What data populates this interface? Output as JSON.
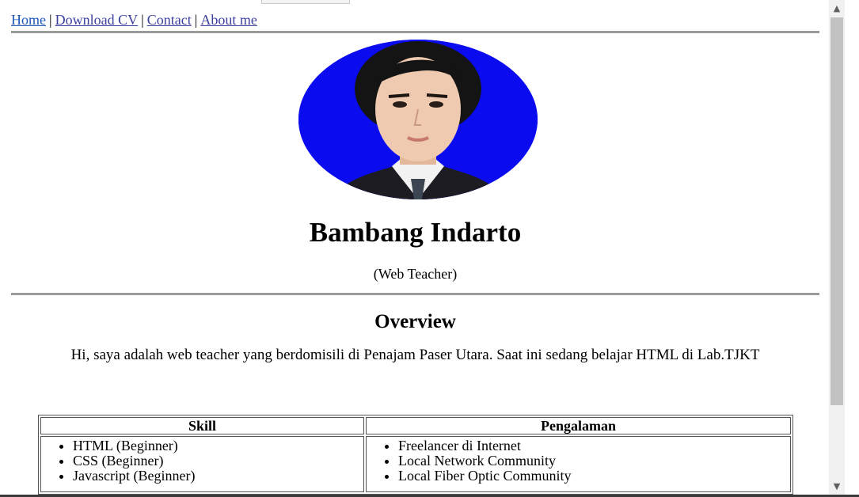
{
  "nav": {
    "links": [
      "Home",
      "Download CV",
      "Contact",
      "About me"
    ],
    "separator": "|"
  },
  "profile": {
    "photo": "profile-photo",
    "name": "Bambang Indarto",
    "role": "(Web Teacher)"
  },
  "overview": {
    "heading": "Overview",
    "text": "Hi, saya adalah web teacher yang berdomisili di Penajam Paser Utara. Saat ini sedang belajar HTML di Lab.TJKT"
  },
  "table": {
    "headers": [
      "Skill",
      "Pengalaman"
    ],
    "skills": [
      "HTML (Beginner)",
      "CSS (Beginner)",
      "Javascript (Beginner)"
    ],
    "experience": [
      "Freelancer di Internet",
      "Local Network Community",
      "Local Fiber Optic Community"
    ]
  },
  "scrollbar": {
    "up_icon": "chevron-up-icon",
    "down_icon": "chevron-down-icon"
  },
  "colors": {
    "link": "#3b3f9e",
    "photo_background": "#0b0bf0",
    "rule": "#9a9a9a"
  }
}
